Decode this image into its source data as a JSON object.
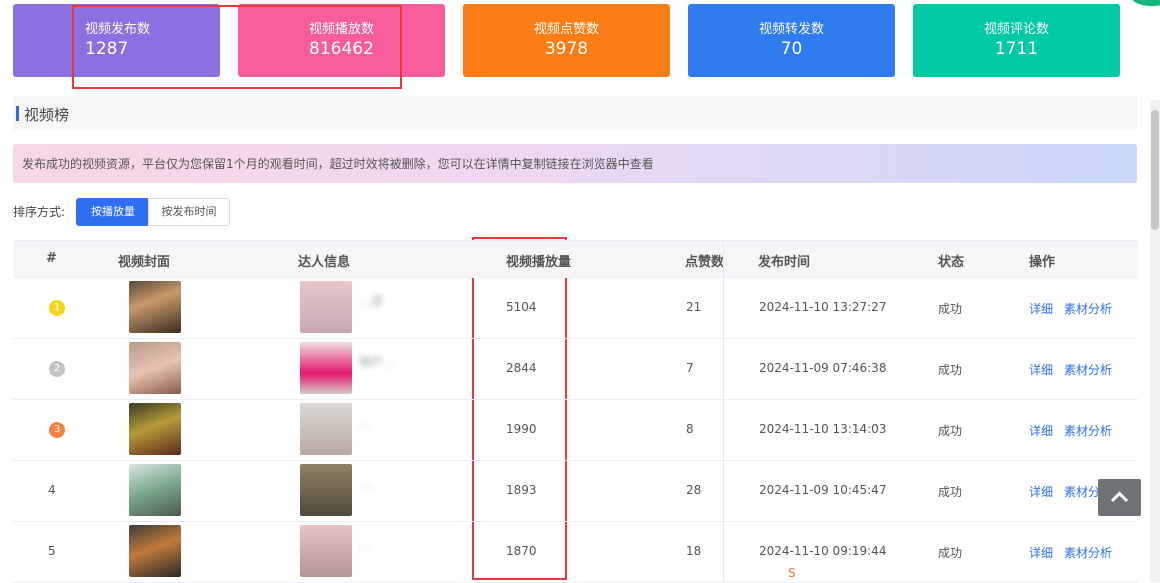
{
  "stats": [
    {
      "label": "视频发布数",
      "value": "1287",
      "color": "#8c6fe0"
    },
    {
      "label": "视频播放数",
      "value": "816462",
      "color": "#f65d9a"
    },
    {
      "label": "视频点赞数",
      "value": "3978",
      "color": "#fc7d15"
    },
    {
      "label": "视频转发数",
      "value": "70",
      "color": "#2f7bf0"
    },
    {
      "label": "视频评论数",
      "value": "1711",
      "color": "#00c9a4"
    }
  ],
  "section": {
    "title": "视频榜"
  },
  "notice": "发布成功的视频资源，平台仅为您保留1个月的观看时间，超过时效将被删除，您可以在详情中复制链接在浏览器中查看",
  "sort": {
    "label": "排序方式:",
    "options": [
      "按播放量",
      "按发布时间"
    ],
    "active": "按播放量"
  },
  "table": {
    "headers": [
      "#",
      "视频封面",
      "达人信息",
      "视频播放量",
      "点赞数",
      "发布时间",
      "状态",
      "操作"
    ],
    "rows": [
      {
        "rank": "1",
        "name": "…凉",
        "plays": "5104",
        "likes": "21",
        "time": "2024-11-10 13:27:27",
        "status": "成功",
        "detail": "详细",
        "analysis": "素材分析"
      },
      {
        "rank": "2",
        "name": "用户…",
        "plays": "2844",
        "likes": "7",
        "time": "2024-11-09 07:46:38",
        "status": "成功",
        "detail": "详细",
        "analysis": "素材分析"
      },
      {
        "rank": "3",
        "name": "…",
        "plays": "1990",
        "likes": "8",
        "time": "2024-11-10 13:14:03",
        "status": "成功",
        "detail": "详细",
        "analysis": "素材分析"
      },
      {
        "rank": "4",
        "name": "…",
        "plays": "1893",
        "likes": "28",
        "time": "2024-11-09 10:45:47",
        "status": "成功",
        "detail": "详细",
        "analysis": "素材分析"
      },
      {
        "rank": "5",
        "name": "…",
        "plays": "1870",
        "likes": "18",
        "time": "2024-11-10 09:19:44",
        "status": "成功",
        "detail": "详细",
        "analysis": "素材分析"
      }
    ],
    "rank_colors": [
      "#f3d51c",
      "#c4c4c4",
      "#f0843f"
    ]
  },
  "icons": {
    "back_to_top": "chevron-up-icon"
  }
}
